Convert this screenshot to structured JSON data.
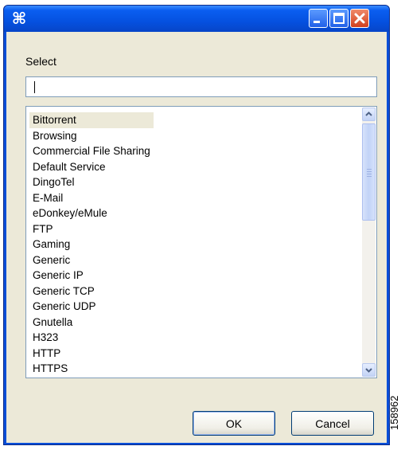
{
  "window": {
    "title_icon": "command-icon",
    "title_icon_glyph": "⌘",
    "controls": [
      "minimize-icon",
      "maximize-icon",
      "close-icon"
    ]
  },
  "dialog": {
    "label": "Select",
    "search_value": "",
    "items": [
      "Bittorrent",
      "Browsing",
      "Commercial File Sharing",
      "Default Service",
      "DingoTel",
      "E-Mail",
      "eDonkey/eMule",
      "FTP",
      "Gaming",
      "Generic",
      "Generic IP",
      "Generic TCP",
      "Generic UDP",
      "Gnutella",
      "H323",
      "HTTP",
      "HTTPS"
    ],
    "selected_item": "Bittorrent",
    "scroll_position": 0,
    "ok_label": "OK",
    "cancel_label": "Cancel"
  },
  "figure_id": "158962",
  "colors": {
    "titlebar": "#0551e0",
    "dialog_bg": "#ece9d8",
    "close_button": "#d2401e",
    "selection": "#ece9d8"
  }
}
